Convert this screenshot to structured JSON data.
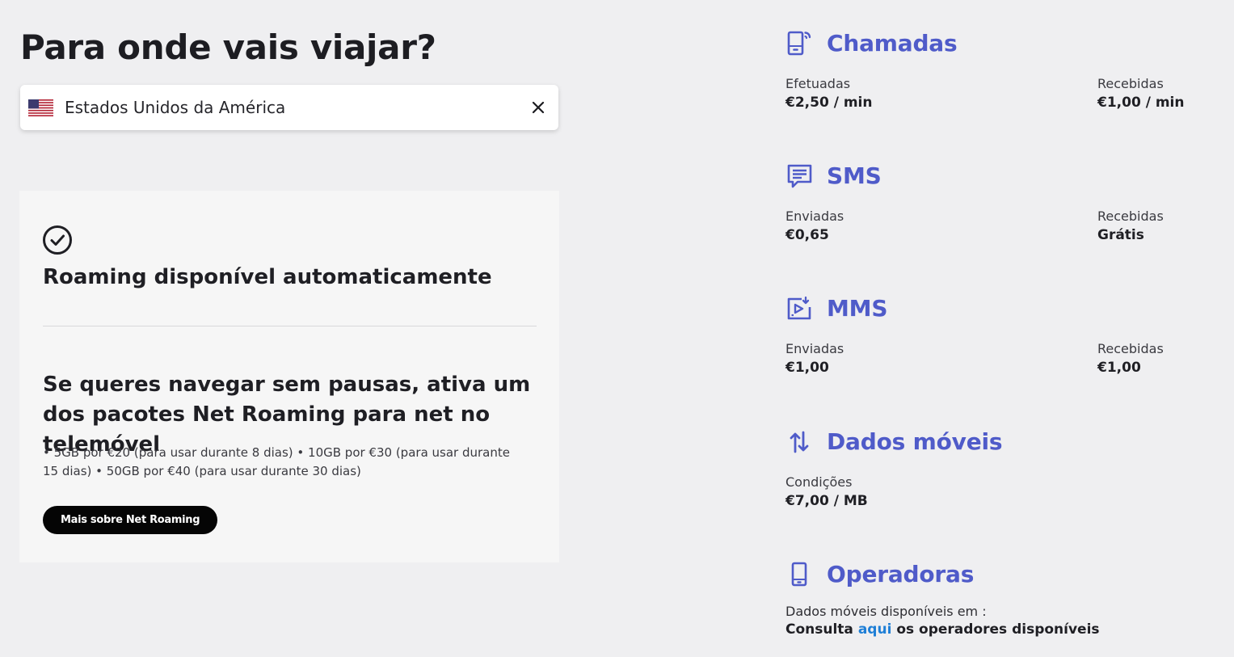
{
  "left": {
    "title": "Para onde vais viajar?",
    "search": {
      "value": "Estados Unidos da América",
      "flag_icon": "us-flag-icon",
      "clear_icon": "close-icon"
    },
    "card": {
      "status_icon": "check-circle-icon",
      "status_title": "Roaming disponível automaticamente",
      "promo_title": "Se queres navegar sem pausas, ativa um dos pacotes Net Roaming para net no telemóvel",
      "promo_desc": "• 5GB por €20 (para usar durante 8 dias) • 10GB por €30 (para usar durante 15 dias) • 50GB por €40 (para usar durante 30 dias)",
      "cta_label": "Mais sobre Net Roaming"
    }
  },
  "right": {
    "accent_color": "#4f5bc9",
    "calls": {
      "icon": "phone-call-icon",
      "title": "Chamadas",
      "made_label": "Efetuadas",
      "made_value": "€2,50 / min",
      "received_label": "Recebidas",
      "received_value": "€1,00 / min"
    },
    "sms": {
      "icon": "message-icon",
      "title": "SMS",
      "sent_label": "Enviadas",
      "sent_value": "€0,65",
      "received_label": "Recebidas",
      "received_value": "Grátis"
    },
    "mms": {
      "icon": "media-message-icon",
      "title": "MMS",
      "sent_label": "Enviadas",
      "sent_value": "€1,00",
      "received_label": "Recebidas",
      "received_value": "€1,00"
    },
    "data": {
      "icon": "up-down-arrows-icon",
      "title": "Dados móveis",
      "cond_label": "Condições",
      "cond_value": "€7,00 / MB"
    },
    "operators": {
      "icon": "mobile-device-icon",
      "title": "Operadoras",
      "label": "Dados móveis disponíveis em :",
      "value_prefix": "Consulta ",
      "link_text": "aqui",
      "value_suffix": " os operadores disponíveis",
      "link_color": "#1f7fd6"
    }
  }
}
